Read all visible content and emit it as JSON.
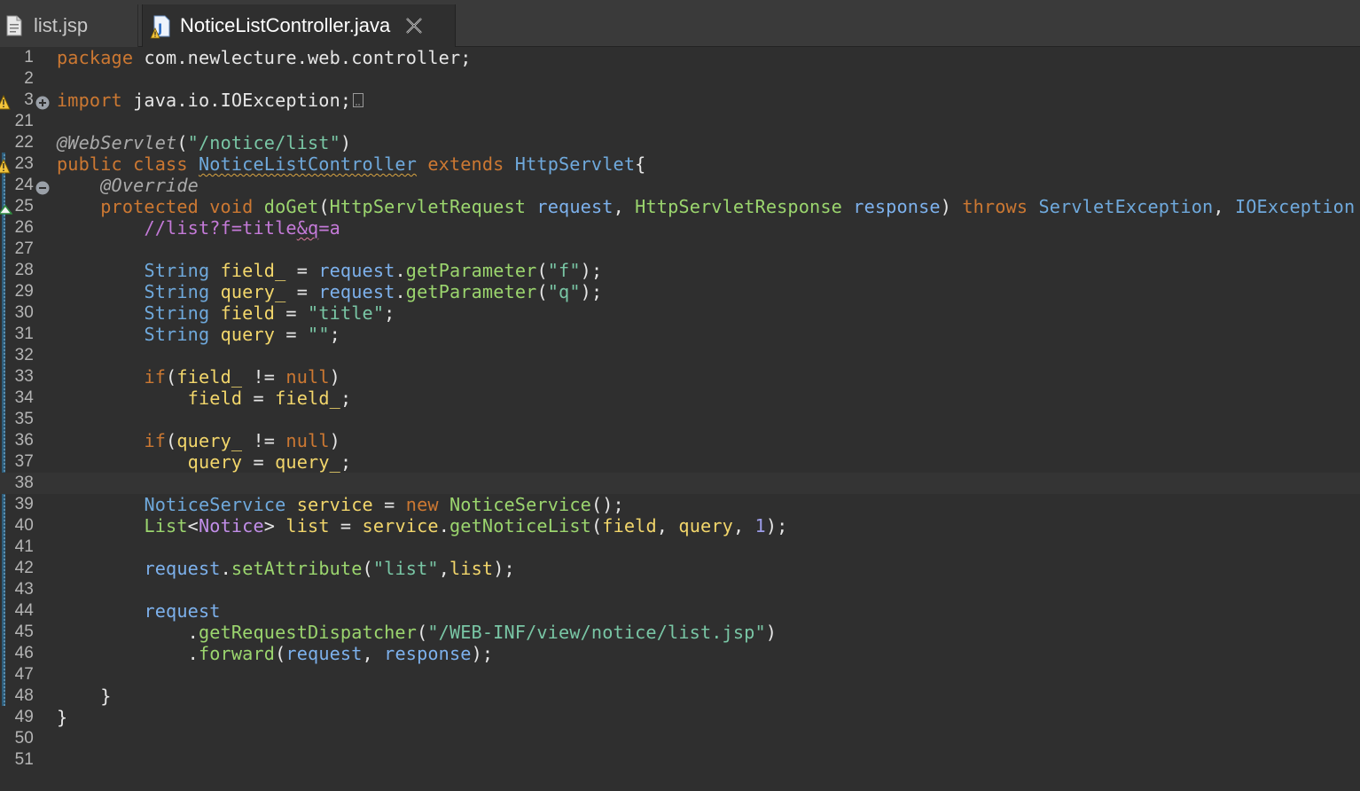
{
  "tabs": [
    {
      "label": "list.jsp",
      "icon": "jsp-file-icon",
      "active": false
    },
    {
      "label": "NoticeListController.java",
      "icon": "java-file-warning-icon",
      "active": true,
      "close_icon": "close-icon"
    }
  ],
  "editor": {
    "current_line": "38",
    "lines": [
      {
        "n": "1",
        "tokens": [
          [
            "kw",
            "package"
          ],
          [
            "plain",
            " com.newlecture.web.controller;"
          ]
        ]
      },
      {
        "n": "2",
        "tokens": []
      },
      {
        "n": "3",
        "tokens": [
          [
            "kw",
            "import"
          ],
          [
            "plain",
            " java.io.IOException;"
          ]
        ]
      },
      {
        "n": "21",
        "tokens": []
      },
      {
        "n": "22",
        "tokens": [
          [
            "ann",
            "@WebServlet"
          ],
          [
            "plain",
            "("
          ],
          [
            "str",
            "\"/notice/list\""
          ],
          [
            "plain",
            ")"
          ]
        ]
      },
      {
        "n": "23",
        "tokens": [
          [
            "kw",
            "public class "
          ],
          [
            "typ squig",
            "NoticeListController"
          ],
          [
            "kw",
            " extends "
          ],
          [
            "typ",
            "HttpServlet"
          ],
          [
            "plain",
            "{"
          ]
        ]
      },
      {
        "n": "24",
        "tokens": [
          [
            "plain",
            "    "
          ],
          [
            "ann",
            "@Override"
          ]
        ]
      },
      {
        "n": "25",
        "tokens": [
          [
            "plain",
            "    "
          ],
          [
            "kw",
            "protected void "
          ],
          [
            "meth",
            "doGet"
          ],
          [
            "plain",
            "("
          ],
          [
            "typ2",
            "HttpServletRequest"
          ],
          [
            "plain",
            " "
          ],
          [
            "param",
            "request"
          ],
          [
            "plain",
            ", "
          ],
          [
            "typ2",
            "HttpServletResponse"
          ],
          [
            "plain",
            " "
          ],
          [
            "param",
            "response"
          ],
          [
            "plain",
            ") "
          ],
          [
            "kw",
            "throws "
          ],
          [
            "typ",
            "ServletException"
          ],
          [
            "plain",
            ", "
          ],
          [
            "typ",
            "IOException"
          ],
          [
            "plain",
            " {"
          ]
        ]
      },
      {
        "n": "26",
        "tokens": [
          [
            "plain",
            "        "
          ],
          [
            "cmt",
            "//list?f=title"
          ],
          [
            "cmt squig-pink",
            "&q"
          ],
          [
            "cmt",
            "=a"
          ]
        ]
      },
      {
        "n": "27",
        "tokens": []
      },
      {
        "n": "28",
        "tokens": [
          [
            "plain",
            "        "
          ],
          [
            "typ",
            "String"
          ],
          [
            "plain",
            " "
          ],
          [
            "var",
            "field_"
          ],
          [
            "plain",
            " = "
          ],
          [
            "param",
            "request"
          ],
          [
            "plain",
            "."
          ],
          [
            "meth",
            "getParameter"
          ],
          [
            "plain",
            "("
          ],
          [
            "str",
            "\"f\""
          ],
          [
            "plain",
            ");"
          ]
        ]
      },
      {
        "n": "29",
        "tokens": [
          [
            "plain",
            "        "
          ],
          [
            "typ",
            "String"
          ],
          [
            "plain",
            " "
          ],
          [
            "var",
            "query_"
          ],
          [
            "plain",
            " = "
          ],
          [
            "param",
            "request"
          ],
          [
            "plain",
            "."
          ],
          [
            "meth",
            "getParameter"
          ],
          [
            "plain",
            "("
          ],
          [
            "str",
            "\"q\""
          ],
          [
            "plain",
            ");"
          ]
        ]
      },
      {
        "n": "30",
        "tokens": [
          [
            "plain",
            "        "
          ],
          [
            "typ",
            "String"
          ],
          [
            "plain",
            " "
          ],
          [
            "var",
            "field"
          ],
          [
            "plain",
            " = "
          ],
          [
            "str",
            "\"title\""
          ],
          [
            "plain",
            ";"
          ]
        ]
      },
      {
        "n": "31",
        "tokens": [
          [
            "plain",
            "        "
          ],
          [
            "typ",
            "String"
          ],
          [
            "plain",
            " "
          ],
          [
            "var",
            "query"
          ],
          [
            "plain",
            " = "
          ],
          [
            "str",
            "\"\""
          ],
          [
            "plain",
            ";"
          ]
        ]
      },
      {
        "n": "32",
        "tokens": []
      },
      {
        "n": "33",
        "tokens": [
          [
            "plain",
            "        "
          ],
          [
            "kw",
            "if"
          ],
          [
            "plain",
            "("
          ],
          [
            "var",
            "field_"
          ],
          [
            "plain",
            " != "
          ],
          [
            "kw",
            "null"
          ],
          [
            "plain",
            ")"
          ]
        ]
      },
      {
        "n": "34",
        "tokens": [
          [
            "plain",
            "            "
          ],
          [
            "var",
            "field"
          ],
          [
            "plain",
            " = "
          ],
          [
            "var",
            "field_"
          ],
          [
            "plain",
            ";"
          ]
        ]
      },
      {
        "n": "35",
        "tokens": []
      },
      {
        "n": "36",
        "tokens": [
          [
            "plain",
            "        "
          ],
          [
            "kw",
            "if"
          ],
          [
            "plain",
            "("
          ],
          [
            "var",
            "query_"
          ],
          [
            "plain",
            " != "
          ],
          [
            "kw",
            "null"
          ],
          [
            "plain",
            ")"
          ]
        ]
      },
      {
        "n": "37",
        "tokens": [
          [
            "plain",
            "            "
          ],
          [
            "var",
            "query"
          ],
          [
            "plain",
            " = "
          ],
          [
            "var",
            "query_"
          ],
          [
            "plain",
            ";"
          ]
        ]
      },
      {
        "n": "38",
        "tokens": []
      },
      {
        "n": "39",
        "tokens": [
          [
            "plain",
            "        "
          ],
          [
            "typ",
            "NoticeService"
          ],
          [
            "plain",
            " "
          ],
          [
            "var",
            "service"
          ],
          [
            "plain",
            " = "
          ],
          [
            "kw",
            "new "
          ],
          [
            "typ2",
            "NoticeService"
          ],
          [
            "plain",
            "();"
          ]
        ]
      },
      {
        "n": "40",
        "tokens": [
          [
            "plain",
            "        "
          ],
          [
            "typ2",
            "List"
          ],
          [
            "plain",
            "<"
          ],
          [
            "gen",
            "Notice"
          ],
          [
            "plain",
            "> "
          ],
          [
            "var",
            "list"
          ],
          [
            "plain",
            " = "
          ],
          [
            "var",
            "service"
          ],
          [
            "plain",
            "."
          ],
          [
            "meth",
            "getNoticeList"
          ],
          [
            "plain",
            "("
          ],
          [
            "var",
            "field"
          ],
          [
            "plain",
            ", "
          ],
          [
            "var",
            "query"
          ],
          [
            "plain",
            ", "
          ],
          [
            "num",
            "1"
          ],
          [
            "plain",
            ");"
          ]
        ]
      },
      {
        "n": "41",
        "tokens": []
      },
      {
        "n": "42",
        "tokens": [
          [
            "plain",
            "        "
          ],
          [
            "param",
            "request"
          ],
          [
            "plain",
            "."
          ],
          [
            "meth",
            "setAttribute"
          ],
          [
            "plain",
            "("
          ],
          [
            "str",
            "\"list\""
          ],
          [
            "plain",
            ","
          ],
          [
            "var",
            "list"
          ],
          [
            "plain",
            ");"
          ]
        ]
      },
      {
        "n": "43",
        "tokens": []
      },
      {
        "n": "44",
        "tokens": [
          [
            "plain",
            "        "
          ],
          [
            "param",
            "request"
          ]
        ]
      },
      {
        "n": "45",
        "tokens": [
          [
            "plain",
            "            ."
          ],
          [
            "meth",
            "getRequestDispatcher"
          ],
          [
            "plain",
            "("
          ],
          [
            "str",
            "\"/WEB-INF/view/notice/list.jsp\""
          ],
          [
            "plain",
            ")"
          ]
        ]
      },
      {
        "n": "46",
        "tokens": [
          [
            "plain",
            "            ."
          ],
          [
            "meth",
            "forward"
          ],
          [
            "plain",
            "("
          ],
          [
            "param",
            "request"
          ],
          [
            "plain",
            ", "
          ],
          [
            "param",
            "response"
          ],
          [
            "plain",
            ");"
          ]
        ]
      },
      {
        "n": "47",
        "tokens": []
      },
      {
        "n": "48",
        "tokens": [
          [
            "plain",
            "    }"
          ]
        ]
      },
      {
        "n": "49",
        "tokens": [
          [
            "plain",
            "}"
          ]
        ]
      },
      {
        "n": "50",
        "tokens": []
      },
      {
        "n": "51",
        "tokens": []
      }
    ]
  },
  "markers": {
    "3": [
      "warning-icon",
      "expand-fold-icon",
      "collapsed-imports-box"
    ],
    "23": [
      "warning-icon"
    ],
    "24": [
      "collapse-fold-icon"
    ],
    "25": [
      "override-arrow-icon"
    ]
  },
  "colors": {
    "background": "#2f2f2f",
    "keyword": "#cc7832",
    "type": "#6fa9dc",
    "string": "#79c6a5",
    "variable": "#f2d66b",
    "comment": "#c47ad8"
  }
}
